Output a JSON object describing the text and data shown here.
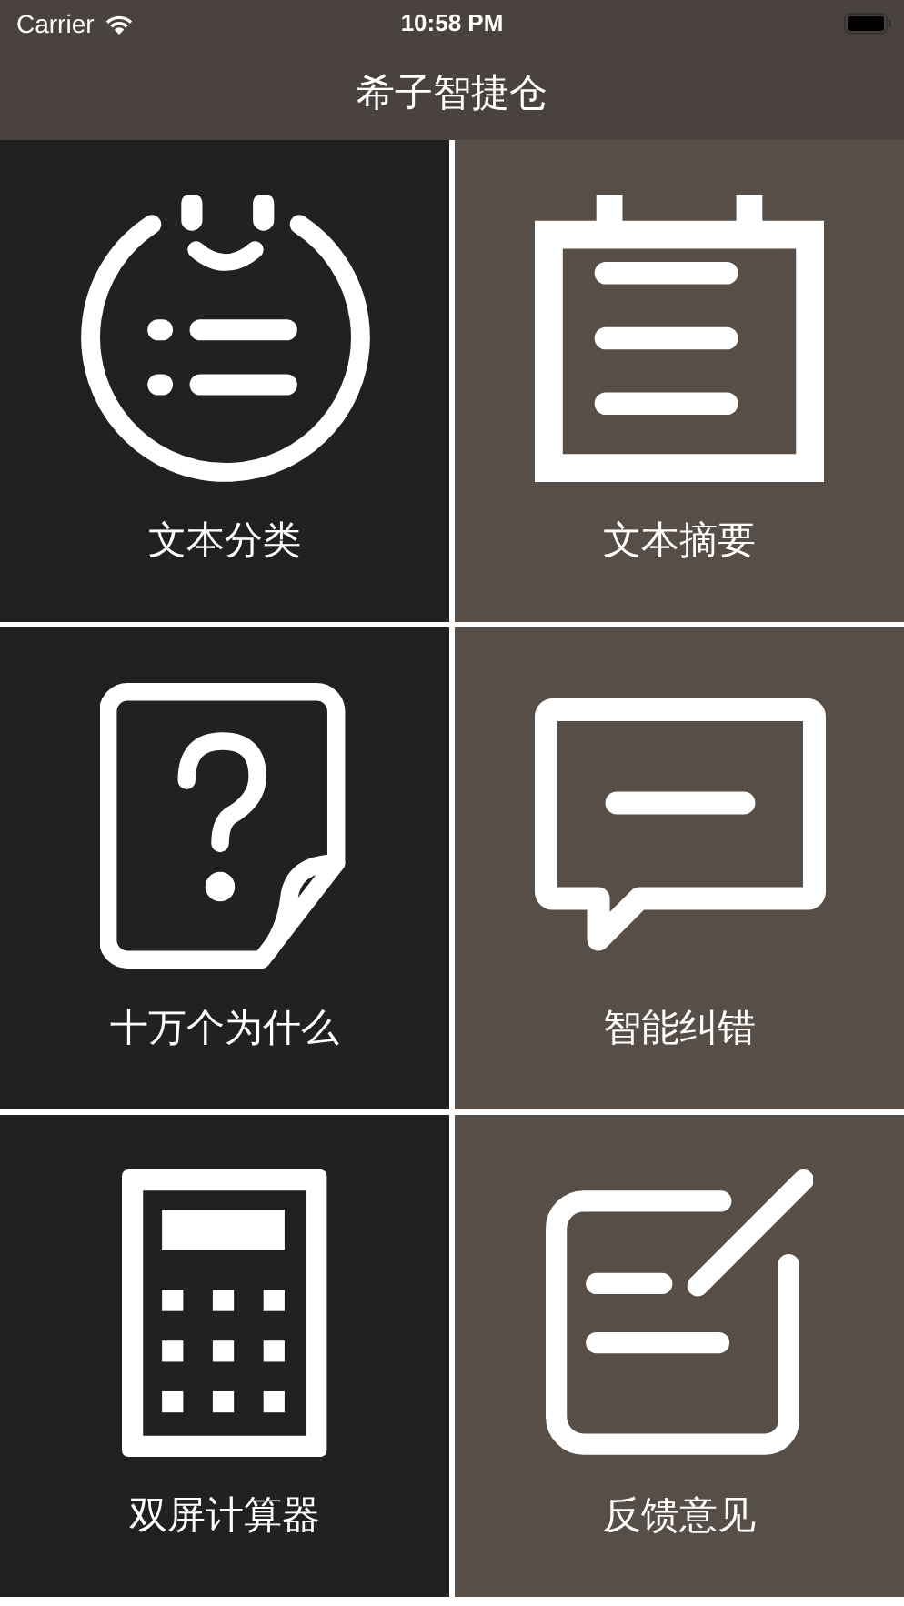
{
  "status_bar": {
    "carrier": "Carrier",
    "time": "10:58 PM"
  },
  "nav_bar": {
    "title": "希子智捷仓"
  },
  "tiles": [
    {
      "label": "文本分类",
      "kind": "classify"
    },
    {
      "label": "文本摘要",
      "kind": "summary"
    },
    {
      "label": "十万个为什么",
      "kind": "question"
    },
    {
      "label": "智能纠错",
      "kind": "correct"
    },
    {
      "label": "双屏计算器",
      "kind": "calculator"
    },
    {
      "label": "反馈意见",
      "kind": "feedback"
    }
  ]
}
